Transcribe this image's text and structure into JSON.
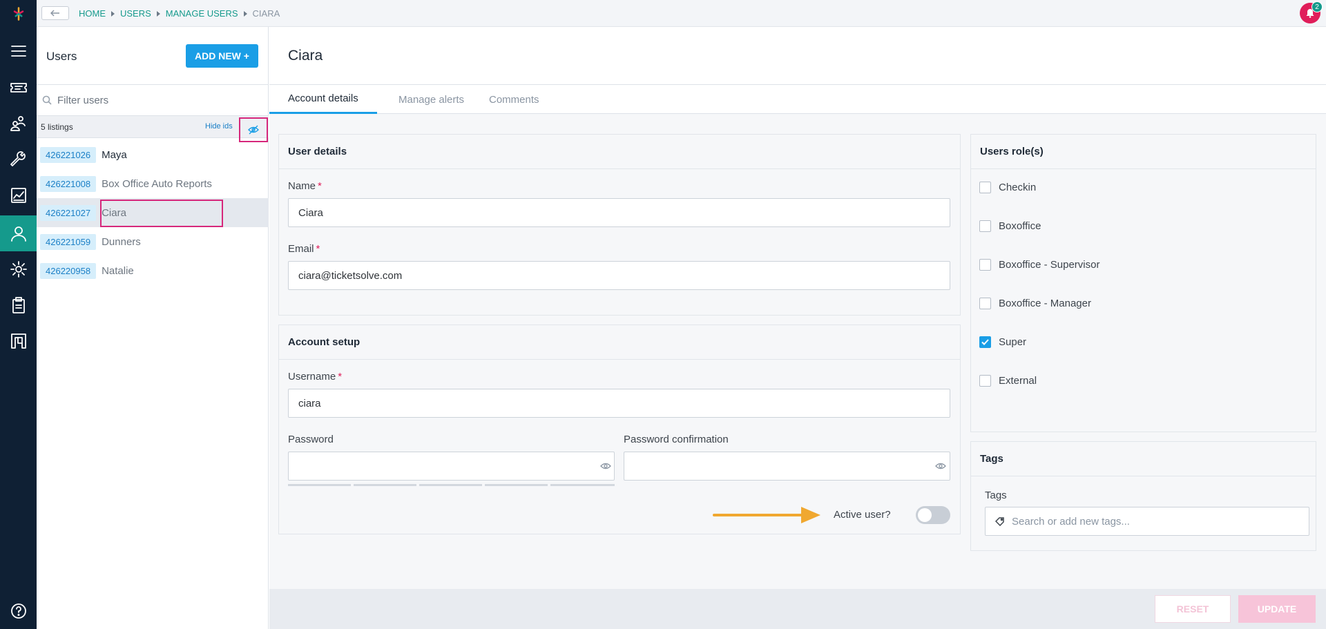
{
  "breadcrumb": [
    {
      "label": "HOME"
    },
    {
      "label": "USERS"
    },
    {
      "label": "MANAGE USERS"
    }
  ],
  "breadcrumb_current": "CIARA",
  "notifications": {
    "count": "2"
  },
  "users_panel": {
    "title": "Users",
    "add_new_label": "ADD NEW +",
    "filter_placeholder": "Filter users",
    "listing_count": "5 listings",
    "hide_ids_label": "Hide ids",
    "users": [
      {
        "id": "426221026",
        "name": "Maya"
      },
      {
        "id": "426221008",
        "name": "Box Office Auto Reports"
      },
      {
        "id": "426221027",
        "name": "Ciara"
      },
      {
        "id": "426221059",
        "name": "Dunners"
      },
      {
        "id": "426220958",
        "name": "Natalie"
      }
    ]
  },
  "main": {
    "title": "Ciara",
    "tabs": [
      {
        "label": "Account details"
      },
      {
        "label": "Manage alerts"
      },
      {
        "label": "Comments"
      }
    ]
  },
  "user_details": {
    "heading": "User details",
    "name_label": "Name",
    "name_value": "Ciara",
    "email_label": "Email",
    "email_value": "ciara@ticketsolve.com"
  },
  "account_setup": {
    "heading": "Account setup",
    "username_label": "Username",
    "username_value": "ciara",
    "password_label": "Password",
    "password_value": "",
    "password_confirm_label": "Password confirmation",
    "password_confirm_value": "",
    "active_label": "Active user?",
    "active": false
  },
  "roles": {
    "heading": "Users role(s)",
    "items": [
      {
        "label": "Checkin",
        "checked": false
      },
      {
        "label": "Boxoffice",
        "checked": false
      },
      {
        "label": "Boxoffice - Supervisor",
        "checked": false
      },
      {
        "label": "Boxoffice - Manager",
        "checked": false
      },
      {
        "label": "Super",
        "checked": true
      },
      {
        "label": "External",
        "checked": false
      }
    ]
  },
  "tags": {
    "heading": "Tags",
    "label": "Tags",
    "placeholder": "Search or add new tags..."
  },
  "footer": {
    "reset_label": "RESET",
    "update_label": "UPDATE"
  },
  "colors": {
    "rail_bg": "#0f2034",
    "rail_active": "#159a8c",
    "accent_blue": "#1a9ee6",
    "annotation_pink": "#d6277b",
    "annotation_arrow": "#f0a830"
  }
}
